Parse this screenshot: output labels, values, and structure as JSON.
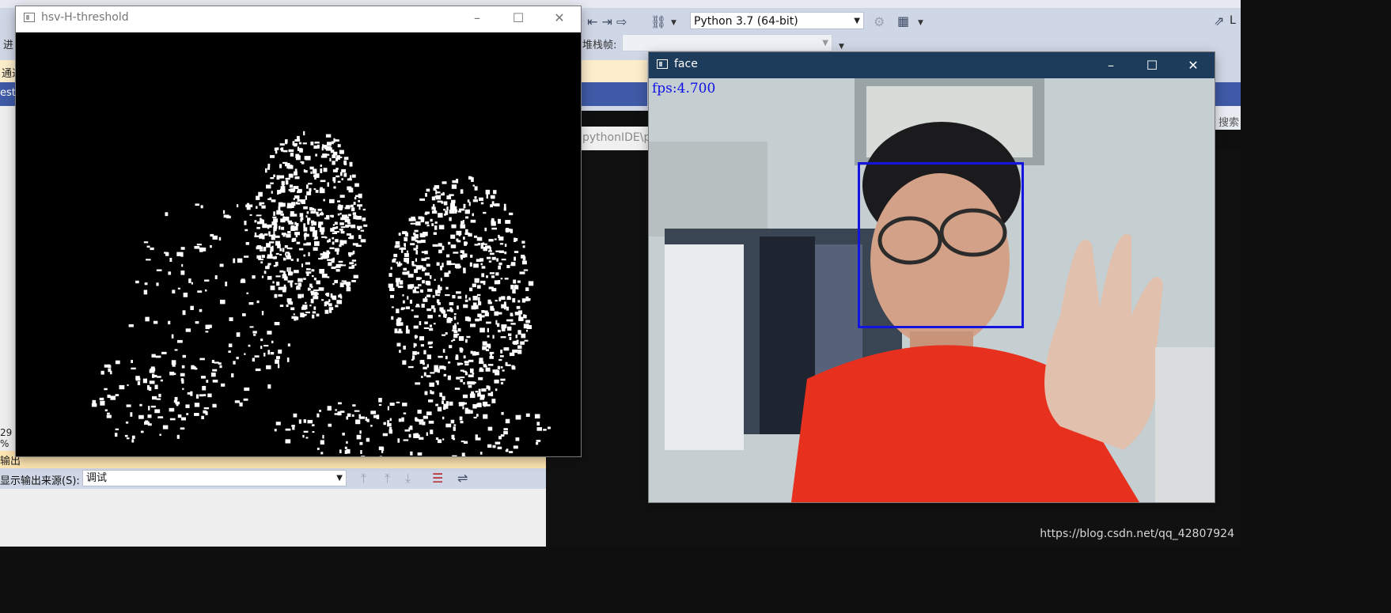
{
  "vs": {
    "interpreter": "Python 3.7 (64-bit)",
    "stackframe_label": "堆栈帧:",
    "left_label_1": "进",
    "left_label_2": "通过",
    "left_label_3": "est",
    "left_label_4": "29 %",
    "left_label_5": "输出",
    "path_text": "pythonIDE\\py",
    "search_label": "搜索",
    "output_source_label": "显示输出来源(S):",
    "output_source_value": "调试",
    "right_label": "L"
  },
  "hsv_window": {
    "title": "hsv-H-threshold"
  },
  "face_window": {
    "title": "face",
    "fps": "fps:4.700",
    "box_color": "#1414e0"
  },
  "watermark": "https://blog.csdn.net/qq_42807924",
  "colors": {
    "face_titlebar": "#1d3c5c",
    "hoodie": "#e8301e",
    "output_header": "#fde4b0"
  }
}
